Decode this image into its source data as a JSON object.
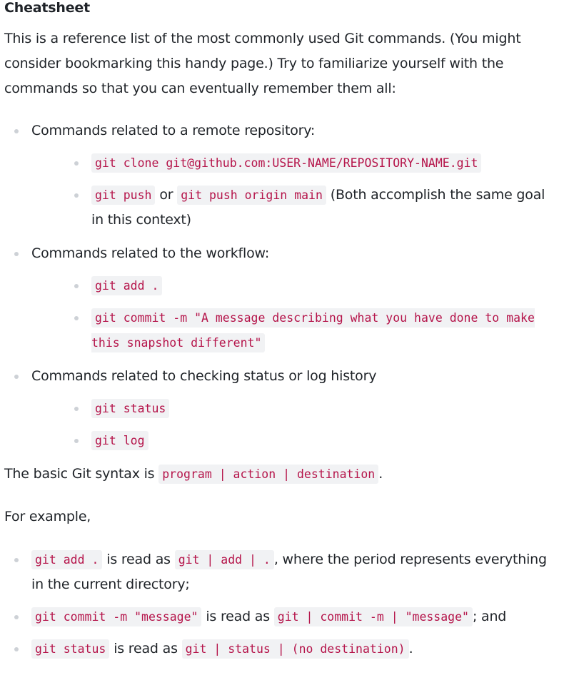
{
  "heading": "Cheatsheet",
  "intro": "This is a reference list of the most commonly used Git commands. (You might consider bookmarking this handy page.) Try to familiarize yourself with the commands so that you can eventually remember them all:",
  "groups": [
    {
      "label": "Commands related to a remote repository:",
      "items": [
        {
          "code": "git clone git@github.com:USER-NAME/REPOSITORY-NAME.git"
        },
        {
          "code": "git push",
          "joiner": "or",
          "code2": "git push origin main",
          "note": "(Both accomplish the same goal in this context)"
        }
      ]
    },
    {
      "label": "Commands related to the workflow:",
      "items": [
        {
          "code": "git add ."
        },
        {
          "code": "git commit -m \"A message describing what you have done to make this snapshot different\""
        }
      ]
    },
    {
      "label": "Commands related to checking status or log history",
      "items": [
        {
          "code": "git status"
        },
        {
          "code": "git log"
        }
      ]
    }
  ],
  "syntax": {
    "prefix": "The basic Git syntax is",
    "code": "program | action | destination",
    "suffix": "."
  },
  "example_intro": "For example,",
  "examples": [
    {
      "code": "git add .",
      "middle": "is read as",
      "code2": "git | add | .",
      "suffix": ", where the period represents everything in the current directory;"
    },
    {
      "code": "git commit -m \"message\"",
      "middle": "is read as",
      "code2": "git | commit -m | \"message\"",
      "suffix": "; and"
    },
    {
      "code": "git status",
      "middle": "is read as",
      "code2": "git | status | (no destination)",
      "suffix": "."
    }
  ]
}
